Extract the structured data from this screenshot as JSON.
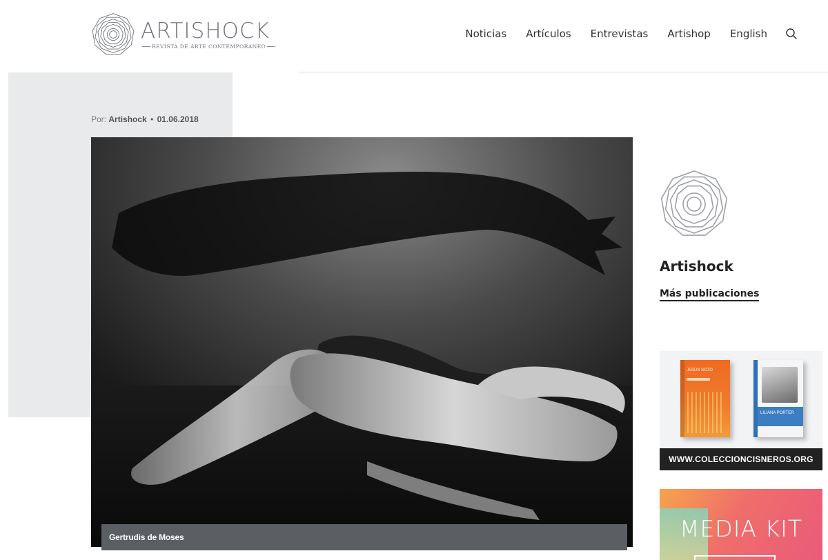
{
  "header": {
    "logo": {
      "title": "ARTISHOCK",
      "subtitle": "REVISTA DE ARTE CONTEMPORANEO"
    },
    "nav": [
      {
        "label": "Noticias"
      },
      {
        "label": "Artículos"
      },
      {
        "label": "Entrevistas"
      },
      {
        "label": "Artishop"
      },
      {
        "label": "English"
      }
    ],
    "search_icon": "search-icon"
  },
  "article": {
    "byline_prefix": "Por:",
    "author": "Artishock",
    "separator": "•",
    "date": "01.06.2018",
    "photo_caption": "Gertrudis de Moses"
  },
  "sidebar": {
    "author_name": "Artishock",
    "more_link": "Más publicaciones",
    "ad1": {
      "url": "WWW.COLECCIONCISNEROS.ORG",
      "book1_text": "JESÚS SOTO",
      "book2_text": "LILIANA PORTER"
    },
    "ad2": {
      "title": "MEDIA KIT"
    }
  },
  "colors": {
    "text": "#222222",
    "logo_grey": "#6f737a",
    "grey_block": "#e9eaec",
    "caption_bar": "#5b5f64"
  }
}
